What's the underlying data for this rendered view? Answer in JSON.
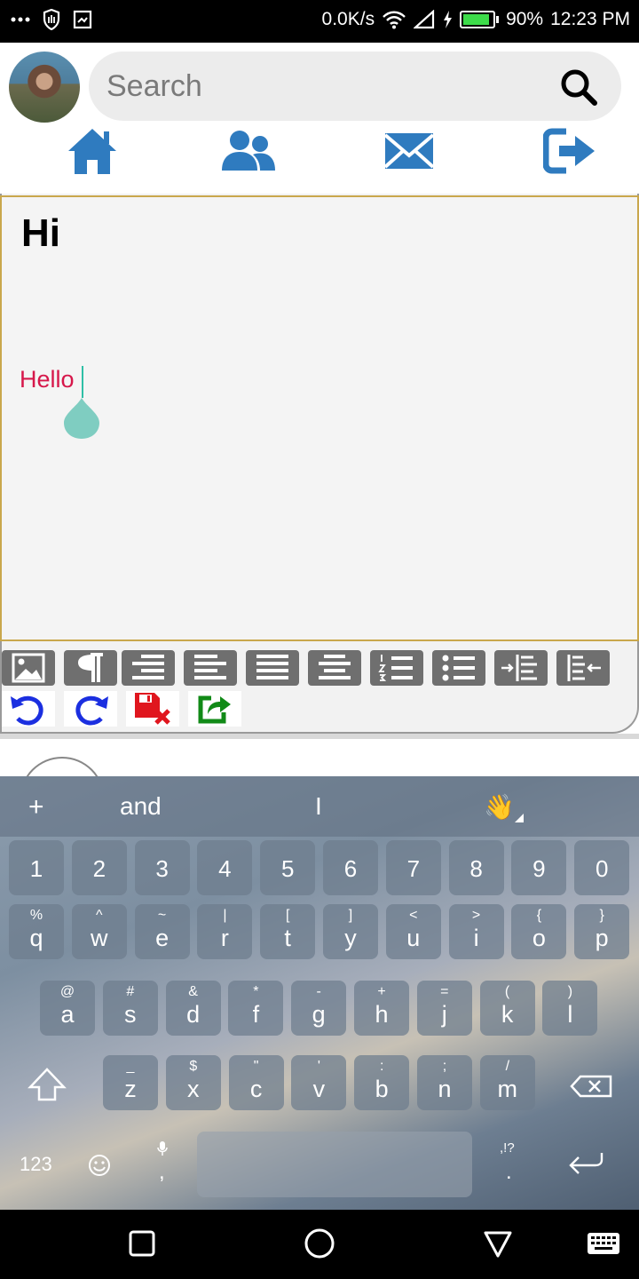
{
  "status_bar": {
    "net_speed": "0.0K/s",
    "battery": "90%",
    "battery_level": 0.9,
    "time": "12:23 PM",
    "icons": [
      "more-icon",
      "shield-icon",
      "screenshot-icon",
      "wifi-icon",
      "signal-icon",
      "charging-icon",
      "battery-icon"
    ]
  },
  "header": {
    "avatar": "user-avatar",
    "search": {
      "placeholder": "Search",
      "value": ""
    },
    "nav_icons": [
      "home-icon",
      "friends-icon",
      "mail-icon",
      "logout-icon"
    ],
    "accent_color": "#2f7bbf"
  },
  "editor": {
    "heading": "Hi",
    "paragraph": "Hello",
    "paragraph_color": "#d6174a",
    "toolbar": [
      "insert-image",
      "paragraph",
      "align-right",
      "align-left",
      "justify",
      "align-center",
      "numbered-list",
      "bullet-list",
      "indent",
      "outdent"
    ],
    "actions": [
      "undo",
      "redo",
      "discard",
      "share"
    ]
  },
  "keyboard": {
    "suggestions": [
      "+",
      "and",
      "I",
      "👋"
    ],
    "row_numbers": [
      "1",
      "2",
      "3",
      "4",
      "5",
      "6",
      "7",
      "8",
      "9",
      "0"
    ],
    "row1": [
      {
        "sub": "%",
        "main": "q"
      },
      {
        "sub": "^",
        "main": "w"
      },
      {
        "sub": "~",
        "main": "e"
      },
      {
        "sub": "|",
        "main": "r"
      },
      {
        "sub": "[",
        "main": "t"
      },
      {
        "sub": "]",
        "main": "y"
      },
      {
        "sub": "<",
        "main": "u"
      },
      {
        "sub": ">",
        "main": "i"
      },
      {
        "sub": "{",
        "main": "o"
      },
      {
        "sub": "}",
        "main": "p"
      }
    ],
    "row2": [
      {
        "sub": "@",
        "main": "a"
      },
      {
        "sub": "#",
        "main": "s"
      },
      {
        "sub": "&",
        "main": "d"
      },
      {
        "sub": "*",
        "main": "f"
      },
      {
        "sub": "-",
        "main": "g"
      },
      {
        "sub": "+",
        "main": "h"
      },
      {
        "sub": "=",
        "main": "j"
      },
      {
        "sub": "(",
        "main": "k"
      },
      {
        "sub": ")",
        "main": "l"
      }
    ],
    "row3": [
      {
        "sub": "_",
        "main": "z"
      },
      {
        "sub": "$",
        "main": "x"
      },
      {
        "sub": "\"",
        "main": "c"
      },
      {
        "sub": "'",
        "main": "v"
      },
      {
        "sub": ":",
        "main": "b"
      },
      {
        "sub": ";",
        "main": "n"
      },
      {
        "sub": "/",
        "main": "m"
      }
    ],
    "bottom": {
      "symbols": "123",
      "comma": ",",
      "period": ".",
      "punct": ",!?"
    }
  },
  "nav_bar": [
    "recents-button",
    "home-button",
    "back-button",
    "keyboard-switch-button"
  ]
}
